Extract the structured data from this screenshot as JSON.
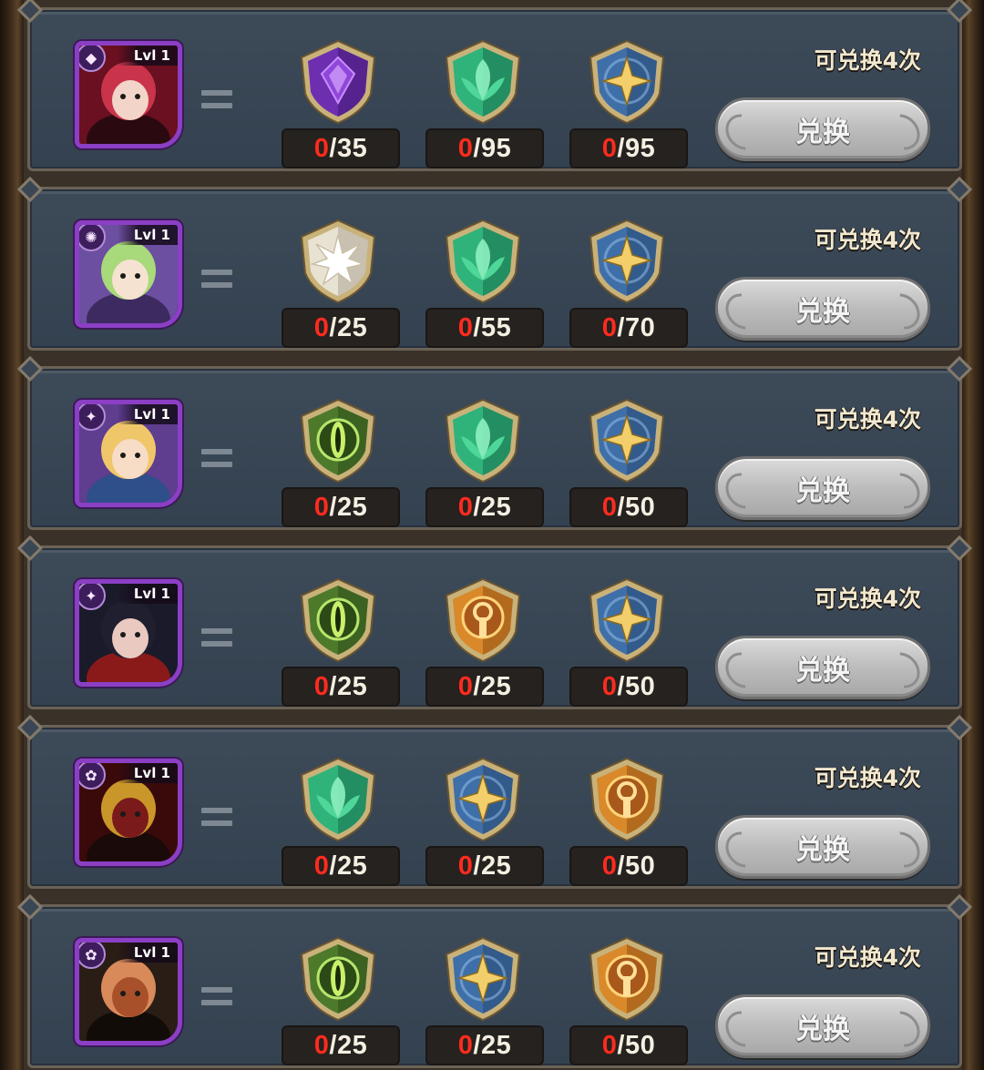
{
  "rows": [
    {
      "hero": {
        "level": "Lvl 1",
        "faction_icon": "dark-faction-icon",
        "portrait": "hero-portrait-demon"
      },
      "costs": [
        {
          "icon": "purple-dark-shard-icon",
          "have": "0",
          "need": "/35"
        },
        {
          "icon": "green-leaf-shard-icon",
          "have": "0",
          "need": "/95"
        },
        {
          "icon": "blue-star-shard-icon",
          "have": "0",
          "need": "/95"
        }
      ],
      "remaining": "可兑换4次",
      "button": "兑换"
    },
    {
      "hero": {
        "level": "Lvl 1",
        "faction_icon": "light-faction-icon",
        "portrait": "hero-portrait-green-hair"
      },
      "costs": [
        {
          "icon": "white-light-shard-icon",
          "have": "0",
          "need": "/25"
        },
        {
          "icon": "green-leaf-shard-icon",
          "have": "0",
          "need": "/55"
        },
        {
          "icon": "blue-star-shard-icon",
          "have": "0",
          "need": "/70"
        }
      ],
      "remaining": "可兑换4次",
      "button": "兑换"
    },
    {
      "hero": {
        "level": "Lvl 1",
        "faction_icon": "star-faction-icon",
        "portrait": "hero-portrait-blonde"
      },
      "costs": [
        {
          "icon": "green-eye-shard-icon",
          "have": "0",
          "need": "/25"
        },
        {
          "icon": "green-leaf-shard-icon",
          "have": "0",
          "need": "/25"
        },
        {
          "icon": "blue-star-shard-icon",
          "have": "0",
          "need": "/50"
        }
      ],
      "remaining": "可兑换4次",
      "button": "兑换"
    },
    {
      "hero": {
        "level": "Lvl 1",
        "faction_icon": "star-faction-icon",
        "portrait": "hero-portrait-dark-hair"
      },
      "costs": [
        {
          "icon": "green-eye-shard-icon",
          "have": "0",
          "need": "/25"
        },
        {
          "icon": "orange-sun-shard-icon",
          "have": "0",
          "need": "/25"
        },
        {
          "icon": "blue-star-shard-icon",
          "have": "0",
          "need": "/50"
        }
      ],
      "remaining": "可兑换4次",
      "button": "兑换"
    },
    {
      "hero": {
        "level": "Lvl 1",
        "faction_icon": "sun-faction-icon",
        "portrait": "hero-portrait-gold-mask"
      },
      "costs": [
        {
          "icon": "green-leaf-shard-icon",
          "have": "0",
          "need": "/25"
        },
        {
          "icon": "blue-star-shard-icon",
          "have": "0",
          "need": "/25"
        },
        {
          "icon": "orange-sun-shard-icon",
          "have": "0",
          "need": "/50"
        }
      ],
      "remaining": "可兑换4次",
      "button": "兑换"
    },
    {
      "hero": {
        "level": "Lvl 1",
        "faction_icon": "sun-faction-icon",
        "portrait": "hero-portrait-beast"
      },
      "costs": [
        {
          "icon": "green-eye-shard-icon",
          "have": "0",
          "need": "/25"
        },
        {
          "icon": "blue-star-shard-icon",
          "have": "0",
          "need": "/25"
        },
        {
          "icon": "orange-sun-shard-icon",
          "have": "0",
          "need": "/50"
        }
      ],
      "remaining": "可兑换4次",
      "button": "兑换"
    }
  ],
  "colors": {
    "have_count": "#ff2b1e",
    "panel": "#3d4b59",
    "portrait_border": "#8b3fc4",
    "button_disabled": "#bdbdbd"
  }
}
